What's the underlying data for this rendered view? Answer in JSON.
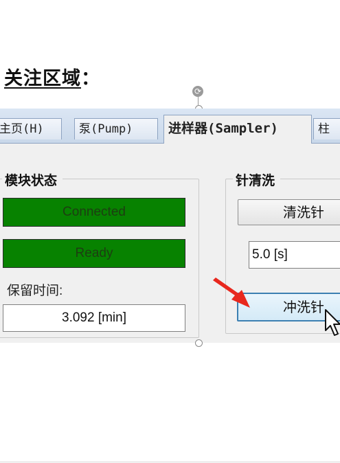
{
  "heading": {
    "text": "关注区域",
    "colon": "："
  },
  "tabs": [
    {
      "label": "主页(H)",
      "active": false
    },
    {
      "label": "泵(Pump)",
      "active": false
    },
    {
      "label": "进样器(Sampler)",
      "active": true
    },
    {
      "label": "柱",
      "active": false
    }
  ],
  "module_status": {
    "title": "模块状态",
    "connection_status": "Connected",
    "ready_status": "Ready",
    "retention_label": "保留时间:",
    "retention_value": "3.092 [min]",
    "status_color": "#078200"
  },
  "needle_wash": {
    "title": "针清洗",
    "wash_button": "清洗针",
    "duration_value": "5.0 [s]",
    "flush_button": "冲洗针"
  },
  "icons": [
    "rotate-handle-icon",
    "red-arrow-icon",
    "mouse-cursor-icon"
  ],
  "accent_colors": {
    "arrow": "#e8281e",
    "tab_bar": "#c9d8ea"
  }
}
